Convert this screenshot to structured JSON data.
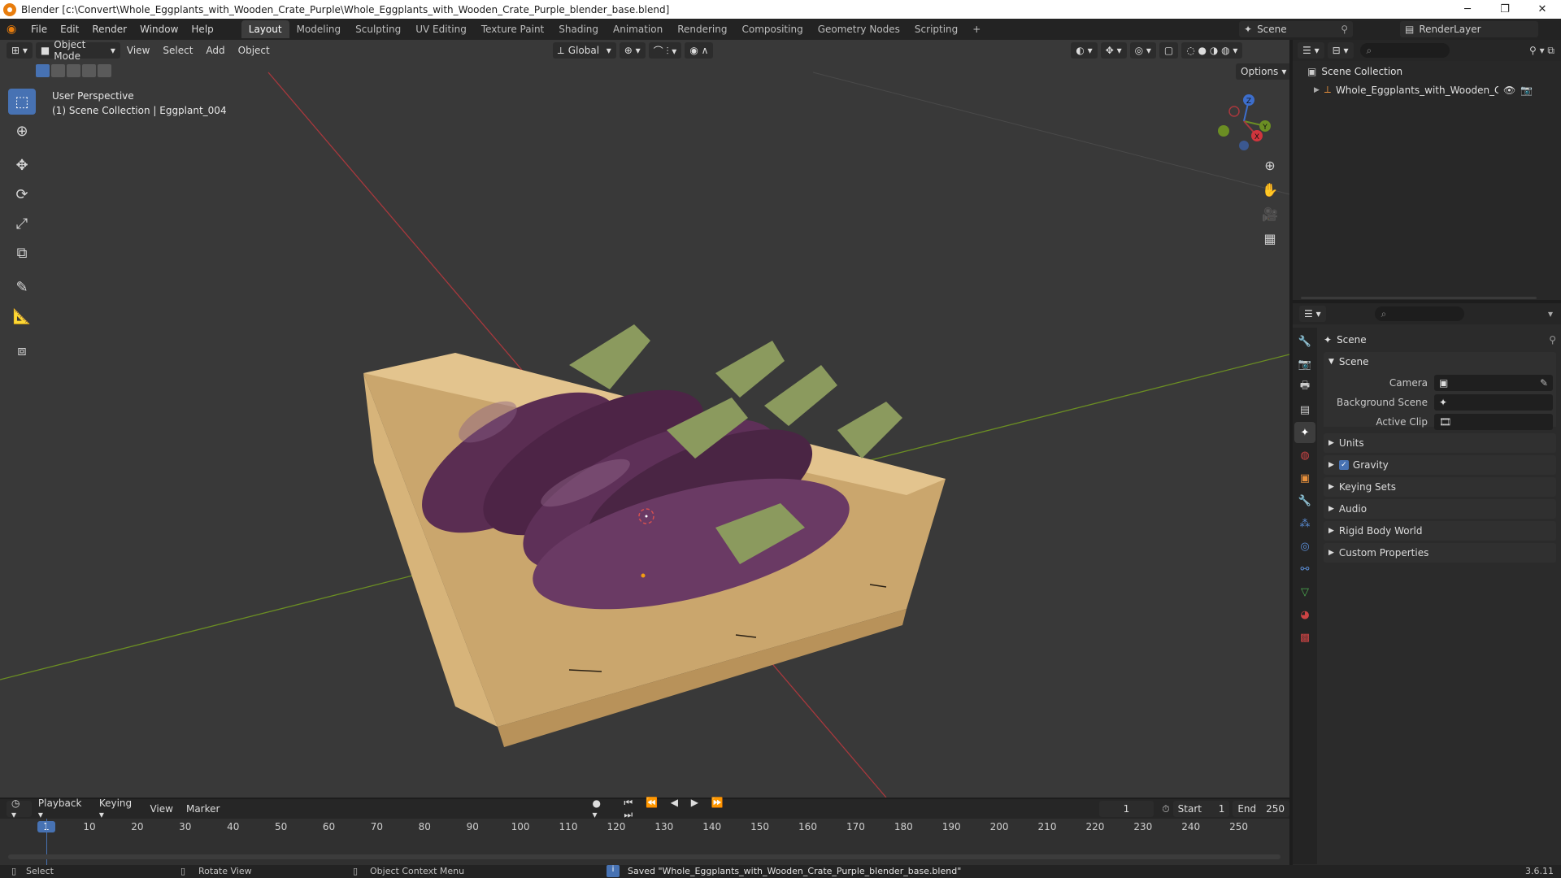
{
  "window": {
    "title": "Blender [c:\\Convert\\Whole_Eggplants_with_Wooden_Crate_Purple\\Whole_Eggplants_with_Wooden_Crate_Purple_blender_base.blend]",
    "minimize_glyph": "─",
    "maximize_glyph": "❐",
    "close_glyph": "✕"
  },
  "menu": [
    "File",
    "Edit",
    "Render",
    "Window",
    "Help"
  ],
  "workspaces": [
    "Layout",
    "Modeling",
    "Sculpting",
    "UV Editing",
    "Texture Paint",
    "Shading",
    "Animation",
    "Rendering",
    "Compositing",
    "Geometry Nodes",
    "Scripting"
  ],
  "active_workspace": "Layout",
  "add_workspace": "+",
  "scene_selector": "Scene",
  "view_layer_selector": "RenderLayer",
  "viewport": {
    "mode": "Object Mode",
    "menus": [
      "View",
      "Select",
      "Add",
      "Object"
    ],
    "orientation": "Global",
    "options_label": "Options",
    "overlay_title": "User Perspective",
    "overlay_subtitle": "(1) Scene Collection | Eggplant_004",
    "gizmo_axes": {
      "x": "X",
      "y": "Y",
      "z": "Z"
    },
    "colors": {
      "x_axis": "#a8383d",
      "y_axis": "#6b8e23",
      "z_axis": "#3d6ecc",
      "selection": "#4772b3"
    }
  },
  "tools": [
    "select-box",
    "cursor",
    "move",
    "rotate",
    "scale",
    "transform",
    "annotate",
    "measure",
    "add-cube"
  ],
  "outliner": {
    "root": "Scene Collection",
    "items": [
      {
        "label": "Whole_Eggplants_with_Wooden_Crate_F"
      }
    ]
  },
  "properties": {
    "header": "Scene",
    "section_scene": "Scene",
    "fields": [
      {
        "label": "Camera",
        "value": ""
      },
      {
        "label": "Background Scene",
        "value": ""
      },
      {
        "label": "Active Clip",
        "value": ""
      }
    ],
    "panels": [
      "Units",
      "Gravity",
      "Keying Sets",
      "Audio",
      "Rigid Body World",
      "Custom Properties"
    ],
    "gravity_checked": true
  },
  "timeline": {
    "menus": [
      "Playback",
      "Keying",
      "View",
      "Marker"
    ],
    "current_frame": "1",
    "start_label": "Start",
    "start_value": "1",
    "end_label": "End",
    "end_value": "250",
    "ticks": [
      "1",
      "10",
      "20",
      "30",
      "40",
      "50",
      "60",
      "70",
      "80",
      "90",
      "100",
      "110",
      "120",
      "130",
      "140",
      "150",
      "160",
      "170",
      "180",
      "190",
      "200",
      "210",
      "220",
      "230",
      "240",
      "250"
    ]
  },
  "statusbar": {
    "select": "Select",
    "rotate": "Rotate View",
    "context": "Object Context Menu",
    "message": "Saved \"Whole_Eggplants_with_Wooden_Crate_Purple_blender_base.blend\"",
    "version": "3.6.11"
  }
}
